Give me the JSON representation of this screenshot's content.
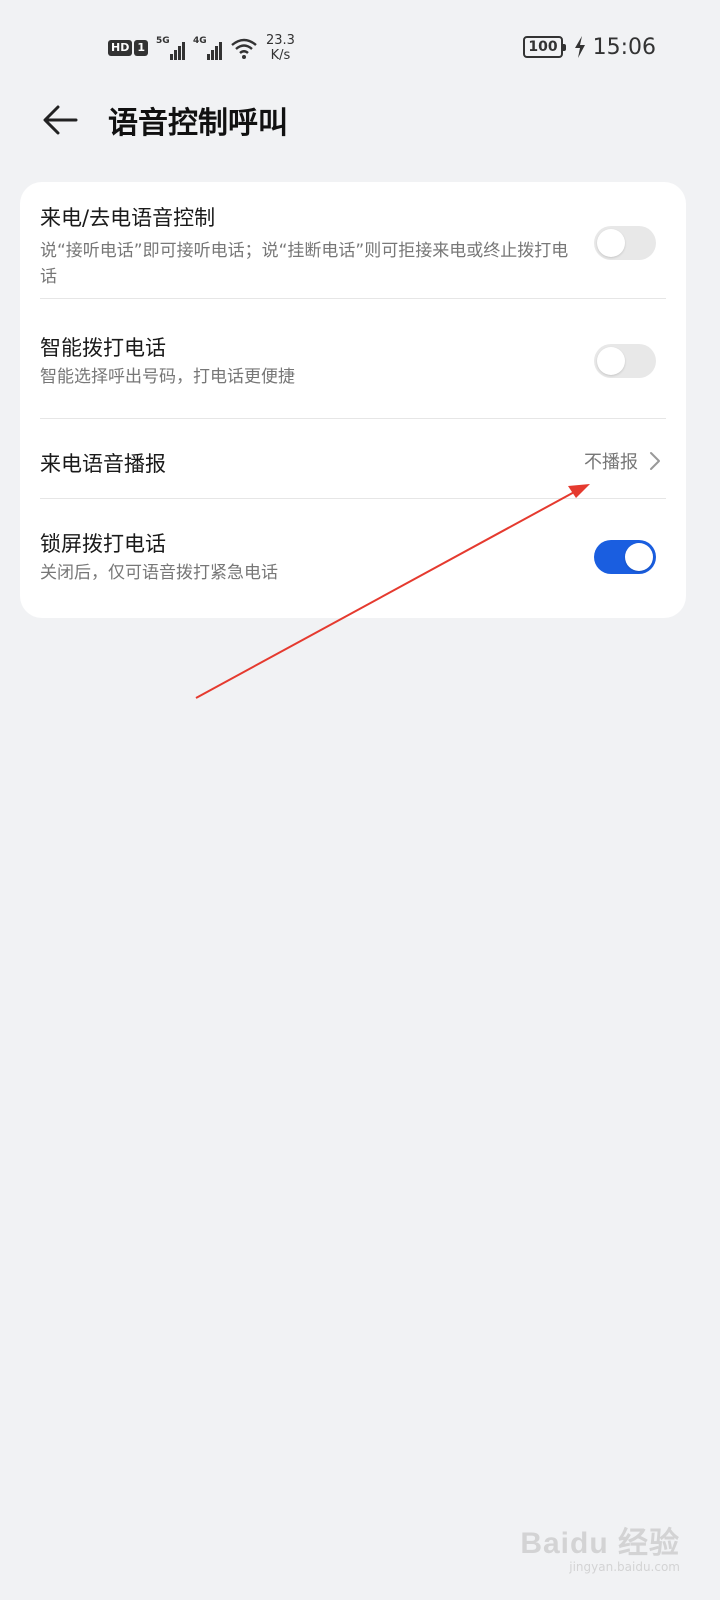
{
  "status_bar": {
    "hd": "HD",
    "sim": "1",
    "net1": "5G",
    "net2": "4G",
    "speed_value": "23.3",
    "speed_unit": "K/s",
    "battery": "100",
    "time": "15:06"
  },
  "header": {
    "title": "语音控制呼叫"
  },
  "settings": [
    {
      "title": "来电/去电语音控制",
      "desc": "说“接听电话”即可接听电话；说“挂断电话”则可拒接来电或终止拨打电话",
      "toggle": false
    },
    {
      "title": "智能拨打电话",
      "desc": "智能选择呼出号码，打电话更便捷",
      "toggle": false
    },
    {
      "title": "来电语音播报",
      "value": "不播报"
    },
    {
      "title": "锁屏拨打电话",
      "desc": "关闭后，仅可语音拨打紧急电话",
      "toggle": true
    }
  ],
  "watermark": {
    "logo": "Baidu 经验",
    "url": "jingyan.baidu.com"
  },
  "colors": {
    "toggle_on": "#1a5ee0",
    "toggle_off": "#e8e8e8",
    "annotation_arrow": "#e53a2f"
  }
}
